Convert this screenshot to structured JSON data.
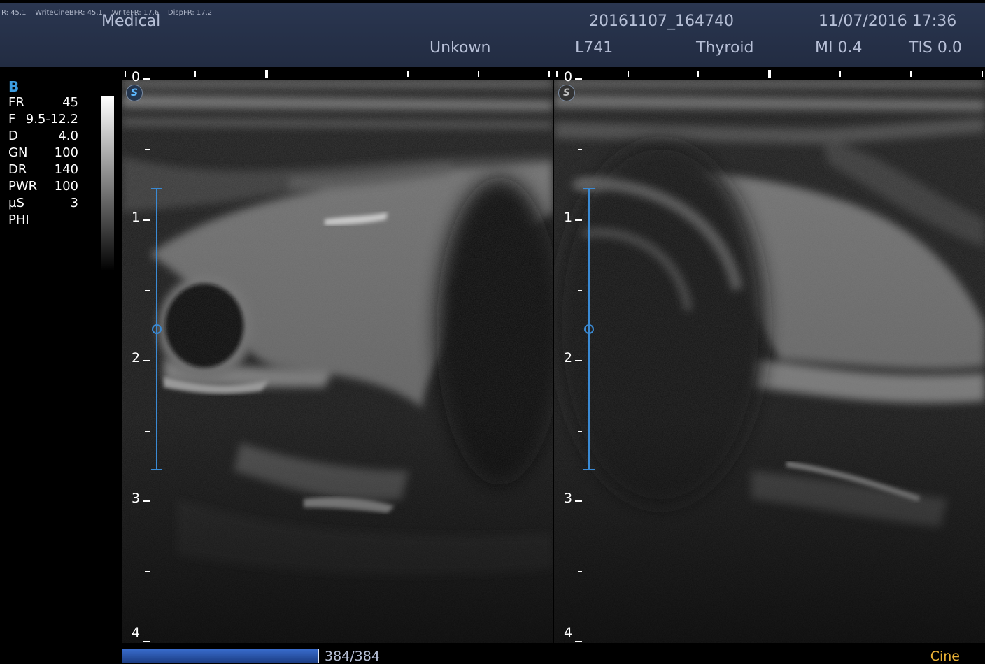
{
  "header": {
    "fps": "R: 45.1    WriteCineBFR: 45.1    WriteFR: 17.6    DispFR: 17.2",
    "hospital": "Medical",
    "study_id": "20161107_164740",
    "datetime": "11/07/2016 17:36",
    "patient": "Unkown",
    "probe": "L741",
    "preset": "Thyroid",
    "mi": "MI 0.4",
    "tis": "TIS 0.0"
  },
  "params": {
    "mode": "B",
    "rows": [
      {
        "k": "FR",
        "v": "45"
      },
      {
        "k": "F",
        "v": "9.5-12.2"
      },
      {
        "k": "D",
        "v": "4.0"
      },
      {
        "k": "GN",
        "v": "100"
      },
      {
        "k": "DR",
        "v": "140"
      },
      {
        "k": "PWR",
        "v": "100"
      },
      {
        "k": "µS",
        "v": "3"
      },
      {
        "k": "PHI",
        "v": ""
      }
    ]
  },
  "depth_labels": [
    "0",
    "1",
    "2",
    "3",
    "4"
  ],
  "badge_letter": "S",
  "footer": {
    "frames": "384/384",
    "cine": "Cine",
    "cine_progress": 1.0
  },
  "colors": {
    "accent": "#3d9de0",
    "cine": "#e8b035",
    "header_bg": "#2a3650"
  }
}
